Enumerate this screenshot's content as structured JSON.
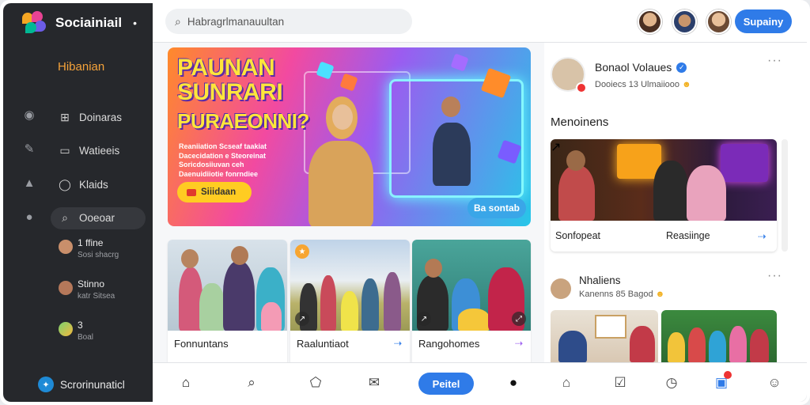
{
  "app": {
    "name": "Sociainiail",
    "section": "Hibanian"
  },
  "sidebar": {
    "nav": [
      {
        "label": "Doinaras",
        "icon": "grid-icon"
      },
      {
        "label": "Watieeis",
        "icon": "bookmark-icon"
      },
      {
        "label": "Klaids",
        "icon": "chat-bubble-icon"
      },
      {
        "label": "Ooeoar",
        "icon": "search-icon"
      }
    ],
    "contacts": [
      {
        "name": "1 ffine",
        "sub": "Sosi shacrg"
      },
      {
        "name": "Stinno",
        "sub": "katr Sitsea"
      },
      {
        "name": "3",
        "sub": "Boal"
      }
    ],
    "footer": "Scrorinunaticl"
  },
  "topbar": {
    "search_placeholder": "Habragrlmanauultan",
    "button": "Supainy"
  },
  "hero": {
    "title_line1": "PAUNAN",
    "title_line2": "SUNRARI",
    "title_line3": "PURAEONNI?",
    "lines": [
      "Reaniiation Scseaf taakiat",
      "Dacecidation e Steoreinat",
      "Soricdosiiuvan ceh",
      "Daenuidiiotie fonrndiee"
    ],
    "cta": "Siiidaan",
    "cta2": "Ba sontab"
  },
  "cards": [
    {
      "caption": "Fonnuntans"
    },
    {
      "caption": "Raaluntiaot"
    },
    {
      "caption": "Rangohomes"
    }
  ],
  "right": {
    "profile_name": "Bonaol Volaues",
    "profile_meta": "Dooiecs 13 Ulmaiiooo",
    "section_title": "Menoinens",
    "memories": [
      "Sonfopeat",
      "Reasiinge"
    ],
    "post2_name": "Nhaliens",
    "post2_meta": "Kanenns 85 Bagod"
  },
  "bottombar": {
    "button": "Peitel"
  }
}
